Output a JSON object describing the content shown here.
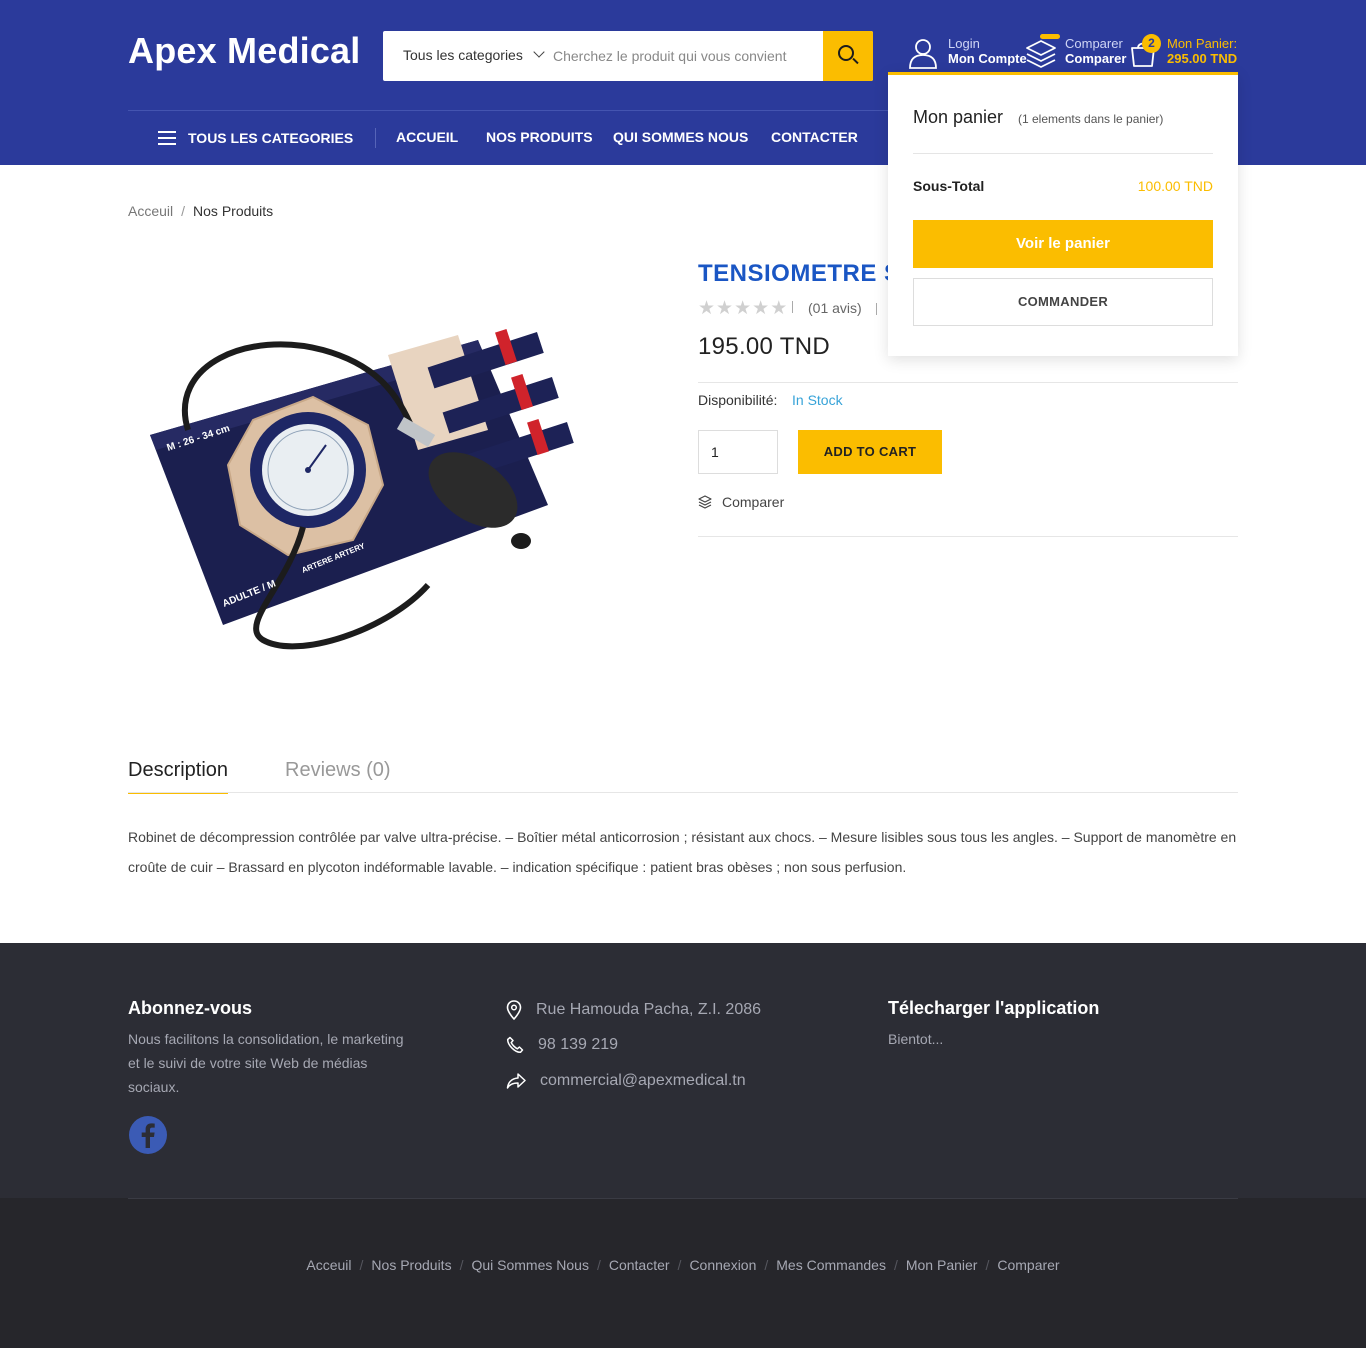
{
  "header": {
    "logo": "Apex Medical",
    "search": {
      "category": "Tous les categories",
      "placeholder": "Cherchez le produit qui vous convient"
    },
    "account": {
      "line1": "Login",
      "line2": "Mon Compte"
    },
    "compare": {
      "line1": "Comparer",
      "line2": "Comparer"
    },
    "cart": {
      "badge": "2",
      "line1": "Mon Panier:",
      "line2": "295.00 TND"
    }
  },
  "nav": {
    "all_categories": "TOUS LES CATEGORIES",
    "links": [
      "ACCUEIL",
      "NOS PRODUITS",
      "QUI SOMMES NOUS",
      "CONTACTER"
    ]
  },
  "cart_dropdown": {
    "title": "Mon panier",
    "count": "(1 elements dans le panier)",
    "subtotal_label": "Sous-Total",
    "subtotal_value": "100.00 TND",
    "view_cart": "Voir le panier",
    "checkout": "COMMANDER"
  },
  "breadcrumb": {
    "home": "Acceuil",
    "separator": "/",
    "current": "Nos Produits"
  },
  "product": {
    "title": "TENSIOMETRE SI",
    "rating": 0,
    "reviews": "(01 avis)",
    "price": "195.00 TND",
    "availability_label": "Disponibilité:",
    "availability_value": "In Stock",
    "quantity": "1",
    "add_to_cart": "ADD TO CART",
    "compare": "Comparer",
    "image_cuff_text": "M : 26 - 34 cm",
    "image_cuff_bottom": "ADULTE / M",
    "image_cuff_artery": "ARTERE ARTERY"
  },
  "tabs": {
    "description": "Description",
    "reviews": "Reviews (0)"
  },
  "description": "Robinet de décompression contrôlée par valve ultra-précise. – Boîtier métal anticorrosion ; résistant aux chocs. – Mesure lisibles sous tous les angles. – Support de manomètre en croûte de cuir – Brassard en plycoton indéformable lavable. – indication spécifique : patient bras obèses ; non sous perfusion.",
  "footer": {
    "subscribe_title": "Abonnez-vous",
    "subscribe_text": "Nous facilitons la consolidation, le marketing et le suivi de votre site Web de médias sociaux.",
    "address": "Rue Hamouda Pacha, Z.I. 2086",
    "phone": "98 139 219",
    "email": "commercial@apexmedical.tn",
    "app_title": "Télecharger l'application",
    "app_text": "Bientot...",
    "links": [
      "Acceuil",
      "Nos Produits",
      "Qui Sommes Nous",
      "Contacter",
      "Connexion",
      "Mes Commandes",
      "Mon Panier",
      "Comparer"
    ],
    "link_separator": "/"
  },
  "colors": {
    "brand_blue": "#2b3a9b",
    "accent_yellow": "#fbbd00",
    "title_blue": "#1a56c4",
    "stock_blue": "#37a3d8",
    "footer_dark": "#2c2d35"
  }
}
